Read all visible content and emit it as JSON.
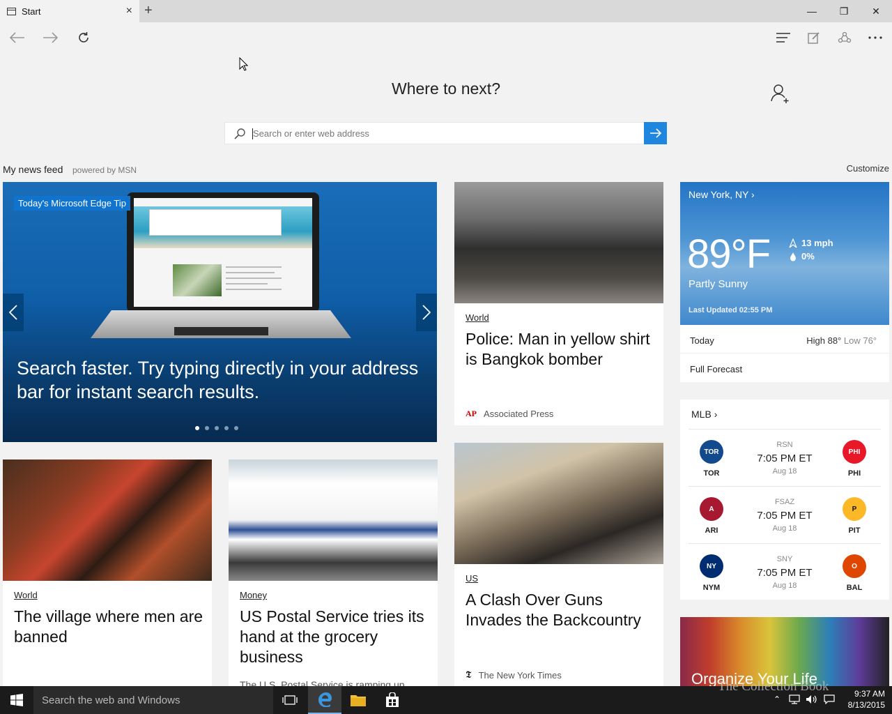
{
  "browser": {
    "tab_title": "Start",
    "tab_close": "×",
    "new_tab": "+",
    "win_min": "—",
    "win_restore": "❐",
    "win_close": "✕"
  },
  "start": {
    "headline": "Where to next?",
    "search_placeholder": "Search or enter web address",
    "feed_label": "My news feed",
    "powered_by": "powered by MSN",
    "customize": "Customize"
  },
  "hero": {
    "tag": "Today's Microsoft Edge Tip",
    "title": "Search faster. Try typing directly in your address bar for instant search results.",
    "slides": 5,
    "active_slide": 1
  },
  "cards": {
    "bangkok": {
      "category": "World",
      "title": "Police: Man in yellow shirt is Bangkok bomber",
      "source": "Associated Press",
      "source_logo": "AP"
    },
    "guns": {
      "category": "US",
      "title": "A Clash Over Guns Invades the Backcountry",
      "source": "The New York Times",
      "source_logo": "𝕿"
    },
    "village": {
      "category": "World",
      "title": "The village where men are banned"
    },
    "usps": {
      "category": "Money",
      "title": "US Postal Service tries its hand at the grocery business",
      "excerpt": "The U.S. Postal Service is ramping up"
    }
  },
  "weather": {
    "city": "New York, NY",
    "temp": "89°F",
    "wind": "13 mph",
    "precip": "0%",
    "condition": "Partly Sunny",
    "updated": "Last Updated 02:55 PM",
    "today_label": "Today",
    "high": "High 88°",
    "low": "Low 76°",
    "forecast_link": "Full Forecast"
  },
  "mlb": {
    "title": "MLB",
    "games": [
      {
        "away": "TOR",
        "home": "PHI",
        "network": "RSN",
        "time": "7:05 PM ET",
        "date": "Aug 18",
        "away_color": "#134a8e",
        "home_color": "#e81828"
      },
      {
        "away": "ARI",
        "home": "PIT",
        "network": "FSAZ",
        "time": "7:05 PM ET",
        "date": "Aug 18",
        "away_color": "#a71930",
        "home_color": "#fdb827"
      },
      {
        "away": "NYM",
        "home": "BAL",
        "network": "SNY",
        "time": "7:05 PM ET",
        "date": "Aug 18",
        "away_color": "#002d72",
        "home_color": "#df4601"
      }
    ]
  },
  "promo": {
    "title": "Organize Your Life"
  },
  "taskbar": {
    "search_placeholder": "Search the web and Windows",
    "time": "9:37 AM",
    "date": "8/13/2015"
  },
  "watermark": "The Collection Book",
  "colors": {
    "accent": "#1f86e0",
    "taskbar": "#1b1b1b"
  }
}
